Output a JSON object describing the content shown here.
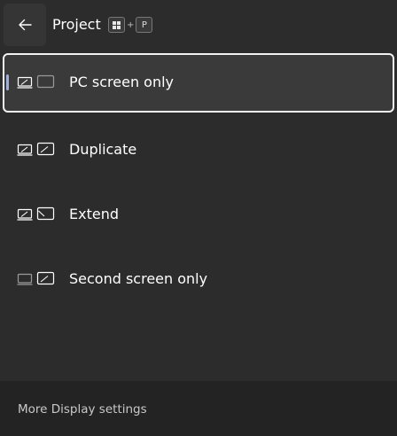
{
  "header": {
    "back_icon": "arrow-left-icon",
    "title": "Project",
    "shortcut": {
      "key1_icon": "windows-logo-icon",
      "plus": "+",
      "key2": "P"
    }
  },
  "options": [
    {
      "label": "PC screen only",
      "icon": "pc-screen-only-icon",
      "selected": true
    },
    {
      "label": "Duplicate",
      "icon": "duplicate-icon",
      "selected": false
    },
    {
      "label": "Extend",
      "icon": "extend-icon",
      "selected": false
    },
    {
      "label": "Second screen only",
      "icon": "second-screen-only-icon",
      "selected": false
    }
  ],
  "footer": {
    "link_label": "More Display settings"
  },
  "colors": {
    "panel_bg": "#2c2c2c",
    "selected_bg": "#3a3a3a",
    "selected_border": "#f2f2f2",
    "accent_indicator": "#9fb0d8",
    "footer_bg": "#232323"
  }
}
